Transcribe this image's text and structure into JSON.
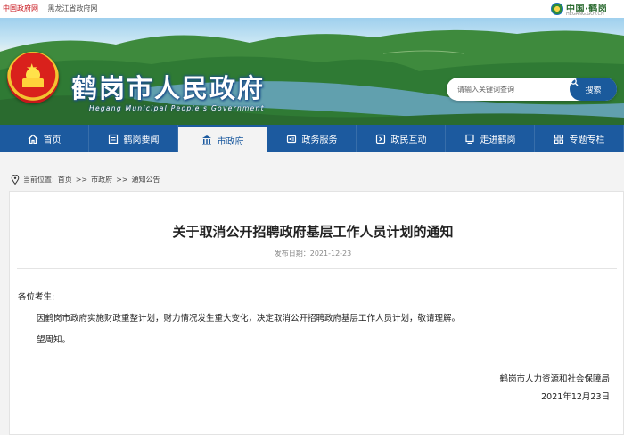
{
  "top_links": [
    "中国政府网",
    "黑龙江省政府网"
  ],
  "top_logo": {
    "name": "中国·鹤岗",
    "url": "HEGANG.GOV.CN"
  },
  "header": {
    "title": "鹤岗市人民政府",
    "subtitle": "Hegang Municipal People's Government"
  },
  "search": {
    "placeholder": "请输入关键词查询",
    "button_label": "搜索"
  },
  "nav": {
    "items": [
      {
        "label": "首页",
        "icon": "home-icon"
      },
      {
        "label": "鹤岗要闻",
        "icon": "news-icon"
      },
      {
        "label": "市政府",
        "icon": "government-building-icon",
        "active": true
      },
      {
        "label": "政务服务",
        "icon": "service-icon"
      },
      {
        "label": "政民互动",
        "icon": "interaction-icon"
      },
      {
        "label": "走进鹤岗",
        "icon": "monitor-icon"
      },
      {
        "label": "专题专栏",
        "icon": "grid-icon"
      }
    ]
  },
  "breadcrumb": {
    "prefix": "当前位置:",
    "items": [
      "首页",
      "市政府",
      "通知公告"
    ],
    "sep": ">>"
  },
  "article": {
    "title": "关于取消公开招聘政府基层工作人员计划的通知",
    "publish_label": "发布日期：2021-12-23",
    "salutation": "各位考生:",
    "body": "因鹤岗市政府实施财政重整计划，财力情况发生重大变化，决定取消公开招聘政府基层工作人员计划，敬请理解。",
    "closing": "望周知。",
    "signer": "鹤岗市人力资源和社会保障局",
    "date": "2021年12月23日"
  },
  "colors": {
    "nav_blue": "#1c5a9f",
    "link_red": "#c8161d",
    "search_blue": "#1a5a9c"
  }
}
